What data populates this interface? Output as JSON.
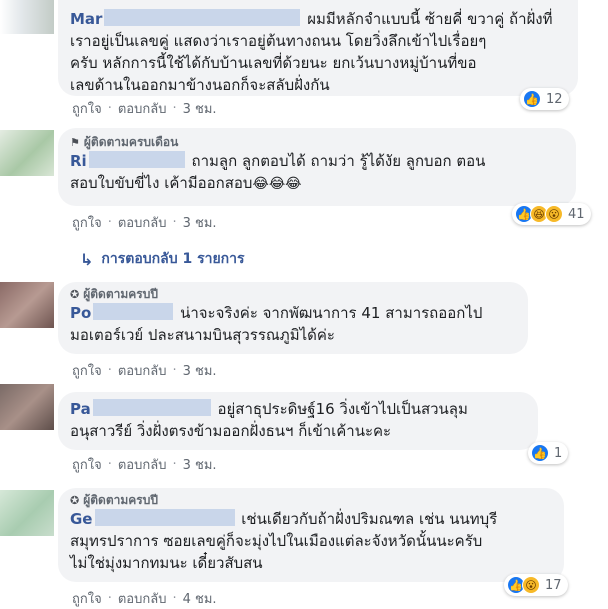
{
  "comments": [
    {
      "name": "Mar",
      "text_lines": [
        "ผมมีหลักจำแบบนี้ ซ้ายคี่ ขวาคู่ ถ้าฝั่งที่",
        "เราอยู่เป็นเลขคู่ แสดงว่าเราอยู่ต้นทางถนน โดยวิ่งลึกเข้าไปเรื่อยๆ",
        "ครับ หลักการนี้ใช้ได้กับบ้านเลขที่ด้วยนะ ยกเว้นบางหมู่บ้านที่ขอ",
        "เลขด้านในออกมาข้างนอกก็จะสลับฝั่งกัน"
      ],
      "like_label": "ถูกใจ",
      "reply_label": "ตอบกลับ",
      "time": "3 ชม.",
      "reaction_count": "12"
    },
    {
      "badge": "ผู้ติดตามครบเดือน",
      "name": "Ri",
      "text_lines": [
        "ถามลูก ลูกตอบได้ ถามว่า รู้ได้งัย ลูกบอก ตอน",
        "สอบใบขับขี่ไง เค้ามีออกสอบ"
      ],
      "emoji": "😂😂😂",
      "like_label": "ถูกใจ",
      "reply_label": "ตอบกลับ",
      "time": "3 ชม.",
      "reaction_count": "41"
    },
    {
      "badge": "ผู้ติดตามครบปี",
      "name": "Po",
      "text_lines": [
        "น่าจะจริงค่ะ จากพัฒนาการ 41 สามารถออกไป",
        "มอเตอร์เวย์ ปละสนามบินสุวรรณภูมิได้ค่ะ"
      ],
      "like_label": "ถูกใจ",
      "reply_label": "ตอบกลับ",
      "time": "3 ชม."
    },
    {
      "name": "Pa",
      "text_lines": [
        "อยู่สาธุประดิษฐ์16 วิ่งเข้าไปเป็นสวนลุม",
        "อนุสาวรีย์ วิ่งฝั่งตรงข้ามออกฝั่งธนฯ ก็เข้าเค้านะคะ"
      ],
      "like_label": "ถูกใจ",
      "reply_label": "ตอบกลับ",
      "time": "3 ชม.",
      "reaction_count": "1"
    },
    {
      "badge": "ผู้ติดตามครบปี",
      "name": "Ge",
      "text_lines": [
        "เช่นเดียวกับถ้าฝั่งปริมณฑล เช่น นนทบุรี",
        "สมุทรปราการ ซอยเลขคู่ก็จะมุ่งไปในเมืองแต่ละจังหวัดนั้นนะครับ",
        "ไม่ใช่มุ่งมากทมนะ เดี๋ยวสับสน"
      ],
      "like_label": "ถูกใจ",
      "reply_label": "ตอบกลับ",
      "time": "4 ชม.",
      "reaction_count": "17"
    }
  ],
  "replies_link": "การตอบกลับ 1 รายการ",
  "icons": {
    "like": "like-icon",
    "haha": "haha-icon",
    "wow": "wow-icon",
    "badge_flag": "flag-icon",
    "badge_star": "star-badge-icon",
    "reply_arrow": "reply-arrow-icon"
  },
  "colors": {
    "name": "#385898",
    "bubble": "#f2f3f5",
    "like": "#1877f2"
  }
}
